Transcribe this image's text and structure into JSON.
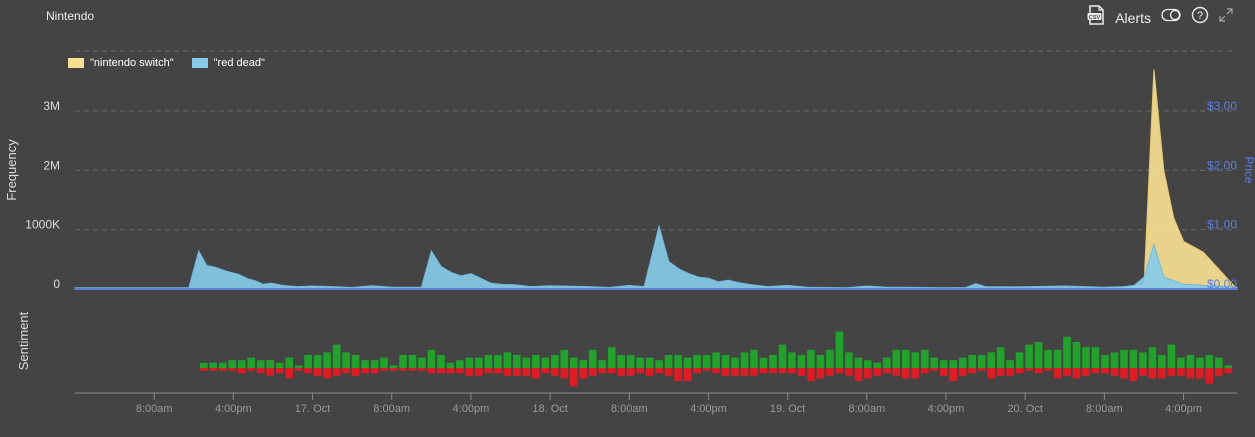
{
  "header": {
    "title": "Nintendo",
    "alerts_label": "Alerts"
  },
  "icons": {
    "csv": "csv-download-icon",
    "toggle": "toggle-icon",
    "help": "help-icon",
    "expand": "expand-icon"
  },
  "colors": {
    "nintendo": "#f7df90",
    "reddead": "#86cbe8",
    "price": "#5b7fe0",
    "positive": "#1fa329",
    "negative": "#e01b24"
  },
  "chart_data": [
    {
      "type": "area",
      "ylabel": "Frequency",
      "y2label": "Price",
      "yticks": [
        "0",
        "1000K",
        "2M",
        "3M"
      ],
      "ylim": [
        0,
        3000000
      ],
      "y2ticks": [
        "$0.00",
        "$1.00",
        "$2.00",
        "$3.00"
      ],
      "y2lim": [
        0,
        3
      ],
      "legend_position": "top-left",
      "grid": true,
      "xticks": [
        "8:00am",
        "4:00pm",
        "17. Oct",
        "8:00am",
        "4:00pm",
        "18. Oct",
        "8:00am",
        "4:00pm",
        "19. Oct",
        "8:00am",
        "4:00pm",
        "20. Oct",
        "8:00am",
        "4:00pm"
      ],
      "xtick_hours": [
        8,
        16,
        24,
        32,
        40,
        48,
        56,
        64,
        72,
        80,
        88,
        96,
        104,
        112
      ],
      "xlim_hours": [
        0,
        117.4
      ],
      "series": [
        {
          "name": "\"nintendo switch\"",
          "points": [
            [
              0,
              0
            ],
            [
              103,
              0
            ],
            [
              108,
              60000
            ],
            [
              109,
              3700000
            ],
            [
              110,
              2000000
            ],
            [
              111,
              1200000
            ],
            [
              112,
              800000
            ],
            [
              114,
              620000
            ],
            [
              117.4,
              0
            ]
          ]
        },
        {
          "name": "\"red dead\"",
          "points": [
            [
              0,
              20000
            ],
            [
              11.5,
              20000
            ],
            [
              12.5,
              640000
            ],
            [
              13.3,
              400000
            ],
            [
              14.3,
              360000
            ],
            [
              15.3,
              300000
            ],
            [
              16.5,
              250000
            ],
            [
              17.5,
              170000
            ],
            [
              18.2,
              140000
            ],
            [
              19,
              80000
            ],
            [
              19.8,
              100000
            ],
            [
              21,
              60000
            ],
            [
              22.5,
              40000
            ],
            [
              24,
              50000
            ],
            [
              26,
              40000
            ],
            [
              28,
              25000
            ],
            [
              30,
              55000
            ],
            [
              32,
              30000
            ],
            [
              35,
              30000
            ],
            [
              36,
              640000
            ],
            [
              37,
              380000
            ],
            [
              38,
              280000
            ],
            [
              39,
              220000
            ],
            [
              40,
              260000
            ],
            [
              41,
              180000
            ],
            [
              42,
              100000
            ],
            [
              43,
              80000
            ],
            [
              44.5,
              70000
            ],
            [
              46,
              40000
            ],
            [
              48,
              55000
            ],
            [
              52,
              40000
            ],
            [
              54,
              25000
            ],
            [
              56,
              60000
            ],
            [
              57.5,
              40000
            ],
            [
              59,
              1060000
            ],
            [
              60,
              460000
            ],
            [
              61,
              340000
            ],
            [
              62,
              260000
            ],
            [
              63,
              200000
            ],
            [
              64,
              180000
            ],
            [
              65,
              120000
            ],
            [
              66,
              150000
            ],
            [
              67,
              110000
            ],
            [
              68,
              80000
            ],
            [
              70,
              40000
            ],
            [
              72,
              60000
            ],
            [
              74,
              30000
            ],
            [
              78,
              20000
            ],
            [
              80,
              50000
            ],
            [
              82,
              30000
            ],
            [
              84,
              30000
            ],
            [
              86,
              25000
            ],
            [
              88,
              20000
            ],
            [
              90,
              25000
            ],
            [
              91,
              90000
            ],
            [
              92,
              40000
            ],
            [
              95,
              35000
            ],
            [
              100,
              50000
            ],
            [
              104,
              30000
            ],
            [
              106,
              40000
            ],
            [
              107,
              60000
            ],
            [
              108,
              200000
            ],
            [
              109,
              750000
            ],
            [
              110,
              200000
            ],
            [
              112,
              80000
            ],
            [
              117.4,
              30000
            ]
          ]
        }
      ]
    },
    {
      "type": "bar",
      "ylabel": "Sentiment",
      "series": [
        {
          "name": "positive",
          "values": [
            2,
            2,
            2,
            3,
            3,
            4,
            3,
            3,
            2,
            4,
            1,
            5,
            5,
            6,
            9,
            6,
            5,
            3,
            3,
            4,
            1,
            5,
            5,
            4,
            7,
            5,
            2,
            3,
            4,
            4,
            5,
            5,
            6,
            5,
            4,
            5,
            4,
            5,
            7,
            4,
            3,
            7,
            3,
            8,
            5,
            5,
            4,
            4,
            3,
            5,
            5,
            4,
            5,
            5,
            6,
            5,
            4,
            6,
            7,
            4,
            5,
            9,
            6,
            5,
            7,
            5,
            7,
            14,
            6,
            4,
            3,
            2,
            4,
            7,
            7,
            6,
            7,
            4,
            3,
            3,
            4,
            5,
            5,
            6,
            8,
            3,
            6,
            9,
            10,
            7,
            7,
            12,
            10,
            8,
            8,
            5,
            6,
            7,
            7,
            6,
            8,
            5,
            9,
            4,
            5,
            4,
            5,
            4,
            1
          ]
        },
        {
          "name": "negative",
          "values": [
            1,
            1,
            1,
            1,
            2,
            1,
            2,
            3,
            2,
            4,
            1,
            2,
            3,
            4,
            3,
            2,
            3,
            2,
            2,
            1,
            1,
            1,
            1,
            1,
            2,
            2,
            2,
            2,
            3,
            3,
            2,
            2,
            3,
            3,
            3,
            4,
            2,
            3,
            4,
            7,
            4,
            3,
            2,
            2,
            3,
            3,
            2,
            3,
            2,
            3,
            5,
            5,
            2,
            1,
            2,
            3,
            3,
            3,
            3,
            2,
            2,
            2,
            2,
            3,
            5,
            4,
            3,
            2,
            3,
            5,
            4,
            3,
            2,
            3,
            4,
            4,
            2,
            1,
            3,
            5,
            3,
            2,
            1,
            4,
            3,
            3,
            2,
            1,
            2,
            1,
            4,
            3,
            4,
            3,
            2,
            2,
            3,
            4,
            5,
            3,
            4,
            4,
            3,
            3,
            4,
            4,
            6,
            3,
            2
          ]
        }
      ]
    }
  ]
}
